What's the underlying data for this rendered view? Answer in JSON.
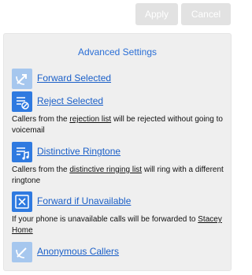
{
  "toolbar": {
    "apply_label": "Apply",
    "cancel_label": "Cancel"
  },
  "panel": {
    "title": "Advanced Settings",
    "items": [
      {
        "label": "Forward Selected",
        "icon": "phone-forward-icon"
      },
      {
        "label": "Reject Selected",
        "icon": "reject-list-icon",
        "desc_before": "Callers from the ",
        "desc_link": "rejection list",
        "desc_after": " will be rejected without going to voicemail"
      },
      {
        "label": "Distinctive Ringtone",
        "icon": "ringtone-list-icon",
        "desc_before": "Callers from the ",
        "desc_link": "distinctive ringing list",
        "desc_after": " will ring with a different ringtone"
      },
      {
        "label": "Forward if Unavailable",
        "icon": "phone-unavailable-icon",
        "desc_before": "If your phone is unavailable calls will be forwarded to ",
        "desc_link": "Stacey Home",
        "desc_after": ""
      },
      {
        "label": "Anonymous Callers",
        "icon": "anonymous-caller-icon"
      }
    ]
  },
  "colors": {
    "accent": "#2f7ae0",
    "accent_faded": "#a6c7ee",
    "link": "#1a5fc8",
    "panel_bg": "#efefef",
    "button_disabled": "#e2e2e2"
  }
}
